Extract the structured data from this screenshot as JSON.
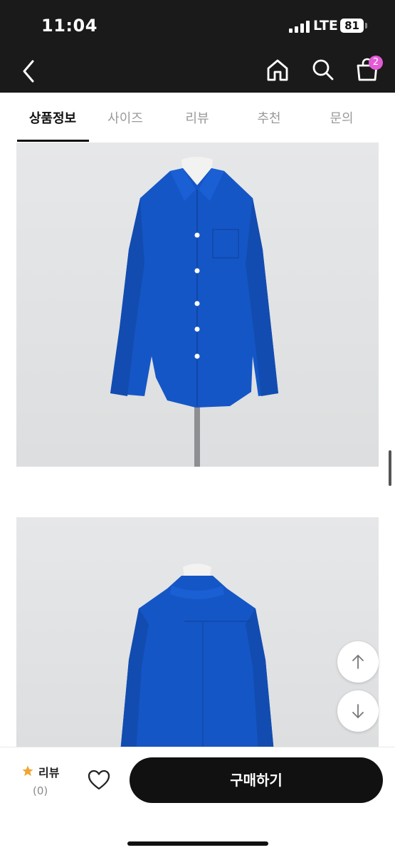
{
  "status_bar": {
    "time": "11:04",
    "network": "LTE",
    "battery": "81"
  },
  "header": {
    "back_icon": "chevron-left-icon",
    "home_icon": "home-icon",
    "search_icon": "search-icon",
    "cart_icon": "shopping-bag-icon",
    "cart_badge": "2",
    "background_color": "#1a1a1a",
    "badge_color": "#e35bd6"
  },
  "tabs": [
    {
      "label": "상품정보",
      "active": true
    },
    {
      "label": "사이즈",
      "active": false
    },
    {
      "label": "리뷰",
      "active": false
    },
    {
      "label": "추천",
      "active": false
    },
    {
      "label": "문의",
      "active": false
    }
  ],
  "product_images": [
    {
      "subject": "blue long-sleeve shirt on mannequin, front view"
    },
    {
      "subject": "blue long-sleeve shirt on mannequin, back view"
    }
  ],
  "shirt_color": "#1556c6",
  "floating_buttons": {
    "up_icon": "arrow-up-icon",
    "down_icon": "arrow-down-icon"
  },
  "bottom_bar": {
    "review_label": "리뷰",
    "review_count": "(0)",
    "star_icon": "star-icon",
    "star_color": "#f0a631",
    "wishlist_icon": "heart-icon",
    "buy_label": "구매하기"
  }
}
